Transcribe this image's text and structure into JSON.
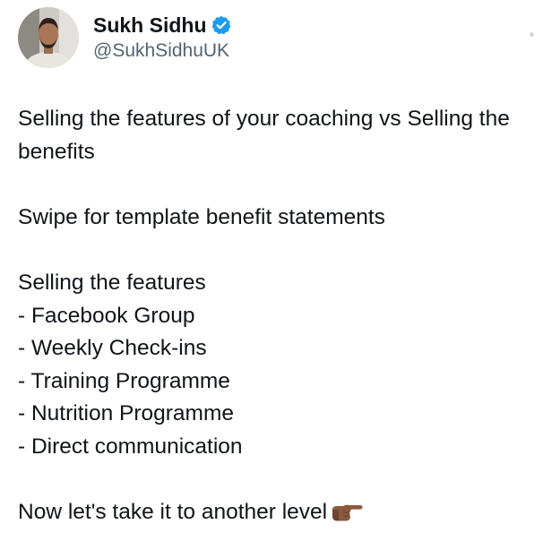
{
  "author": {
    "display_name": "Sukh Sidhu",
    "handle": "@SukhSidhuUK",
    "verified": true,
    "verified_color": "#1d9bf0"
  },
  "post": {
    "intro": "Selling the features of your coaching  vs  Selling the benefits",
    "swipe": "Swipe for  template benefit statements",
    "list_heading": "Selling the features",
    "list_items": [
      "- Facebook Group",
      "- Weekly Check-ins",
      "- Training Programme",
      "- Nutrition Programme",
      "- Direct communication"
    ],
    "closing": "Now let's take it to another level",
    "closing_emoji": "backhand-index-pointing-right-icon"
  },
  "colors": {
    "text": "#0f1419",
    "secondary_text": "#536471",
    "accent": "#1d9bf0"
  }
}
